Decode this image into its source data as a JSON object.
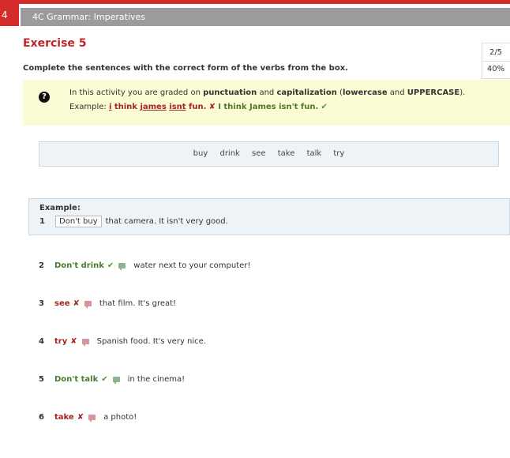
{
  "header": {
    "unit_number": "4",
    "title": "4C Grammar: Imperatives"
  },
  "exercise": {
    "title": "Exercise 5",
    "instructions": "Complete the sentences with the correct form of the verbs from the box."
  },
  "score": {
    "fraction": "2/5",
    "percent": "40%"
  },
  "info": {
    "line1_pre": "In this activity you are graded on ",
    "punctuation": "punctuation",
    "and1": " and ",
    "capitalization": "capitalization",
    "paren_open": " (",
    "lowercase": "lowercase",
    "and2": " and ",
    "uppercase": "UPPERCASE",
    "paren_close": ").",
    "example_label": "Example: ",
    "wrong_w1": "i",
    "wrong_w2": "think",
    "wrong_w3": "james",
    "wrong_w4": "isnt",
    "wrong_w5": "fun.",
    "x": "✘",
    "correct": "I think James isn't fun.",
    "check": "✔"
  },
  "word_box": [
    "buy",
    "drink",
    "see",
    "take",
    "talk",
    "try"
  ],
  "example": {
    "label": "Example:",
    "number": "1",
    "answer": "Don't buy",
    "text": "that camera. It isn't very good."
  },
  "items": [
    {
      "number": "2",
      "answer": "Don't drink",
      "mark": "✔",
      "text": "water next to your computer!"
    },
    {
      "number": "3",
      "answer": "see",
      "mark": "✘",
      "text": "that film. It's great!"
    },
    {
      "number": "4",
      "answer": "try",
      "mark": "✘",
      "text": "Spanish food. It's very nice."
    },
    {
      "number": "5",
      "answer": "Don't talk",
      "mark": "✔",
      "text": "in the cinema!"
    },
    {
      "number": "6",
      "answer": "take",
      "mark": "✘",
      "text": "a photo!"
    }
  ],
  "colors": {
    "accent": "#d62b2b",
    "correct": "#4c7a2c",
    "wrong": "#a52525",
    "info_bg": "#fbfbd4"
  }
}
